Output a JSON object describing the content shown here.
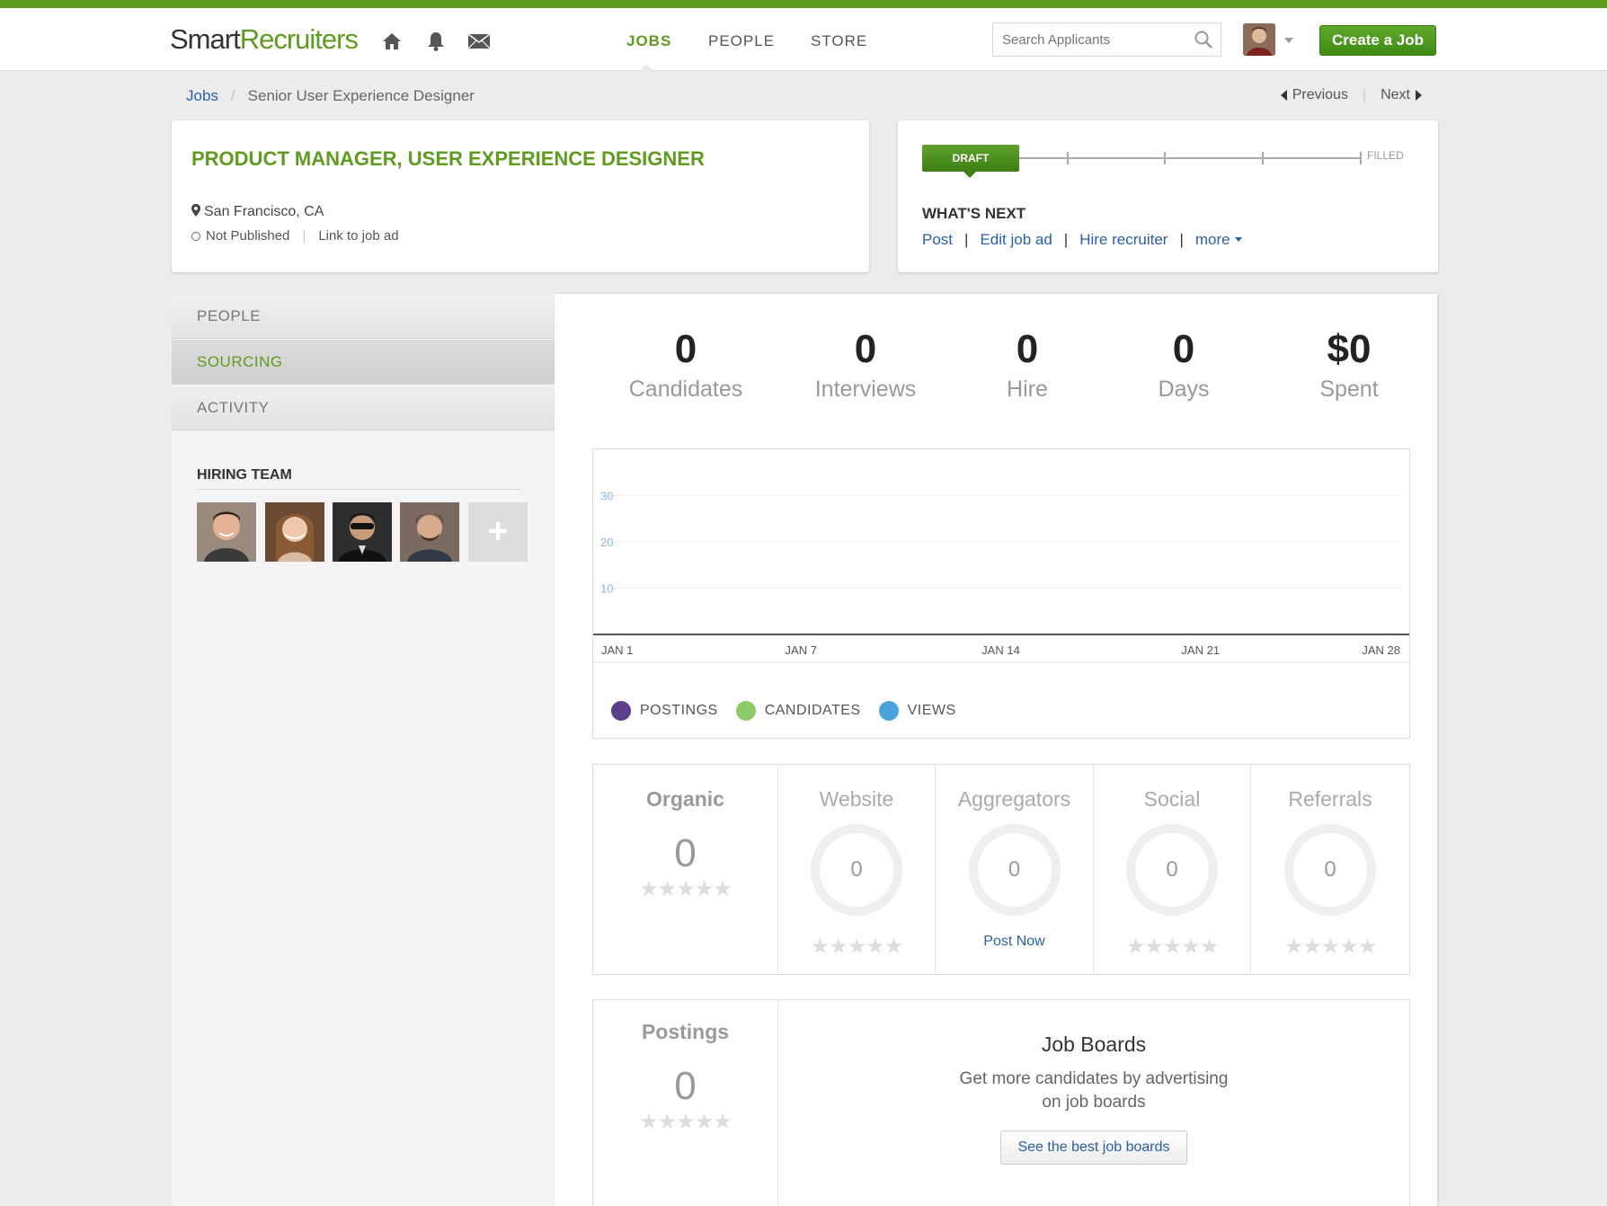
{
  "header": {
    "logo_part1": "Smart",
    "logo_part2": "Recruiters",
    "nav": [
      {
        "label": "JOBS",
        "active": true
      },
      {
        "label": "PEOPLE",
        "active": false
      },
      {
        "label": "STORE",
        "active": false
      }
    ],
    "search_placeholder": "Search Applicants",
    "create_label": "Create a Job",
    "accent_color": "#5e9b1f"
  },
  "breadcrumb": {
    "root": "Jobs",
    "current": "Senior User Experience Designer"
  },
  "pager": {
    "previous": "Previous",
    "next": "Next"
  },
  "job": {
    "title": "PRODUCT MANAGER, USER EXPERIENCE DESIGNER",
    "location": "San Francisco, CA",
    "status": "Not Published",
    "link": "Link to job ad"
  },
  "workflow": {
    "current_stage": "DRAFT",
    "end_stage": "FILLED",
    "whats_next_title": "WHAT'S NEXT",
    "links": [
      "Post",
      "Edit job ad",
      "Hire recruiter",
      "more"
    ]
  },
  "sidebar": {
    "tabs": [
      {
        "label": "PEOPLE",
        "active": false
      },
      {
        "label": "SOURCING",
        "active": true
      },
      {
        "label": "ACTIVITY",
        "active": false
      }
    ],
    "team_title": "HIRING TEAM",
    "add_label": "+"
  },
  "stats": [
    {
      "value": "0",
      "label": "Candidates"
    },
    {
      "value": "0",
      "label": "Interviews"
    },
    {
      "value": "0",
      "label": "Hire"
    },
    {
      "value": "0",
      "label": "Days"
    },
    {
      "value": "$0",
      "label": "Spent"
    }
  ],
  "chart_data": {
    "type": "line",
    "x": [
      "JAN 1",
      "JAN 7",
      "JAN 14",
      "JAN 21",
      "JAN 28"
    ],
    "yticks": [
      10,
      20,
      30
    ],
    "ylim": [
      0,
      40
    ],
    "series": [
      {
        "name": "POSTINGS",
        "color": "#5b3f8a",
        "values": [
          0,
          0,
          0,
          0,
          0
        ]
      },
      {
        "name": "CANDIDATES",
        "color": "#8cc967",
        "values": [
          0,
          0,
          0,
          0,
          0
        ]
      },
      {
        "name": "VIEWS",
        "color": "#4aa3db",
        "values": [
          0,
          0,
          0,
          0,
          0
        ]
      }
    ],
    "grid": true,
    "legend": "bottom-left"
  },
  "sources": [
    {
      "title": "Organic",
      "value": "0",
      "stars": "★★★★★"
    },
    {
      "title": "Website",
      "value": "0",
      "stars": "★★★★★"
    },
    {
      "title": "Aggregators",
      "value": "0",
      "action": "Post Now"
    },
    {
      "title": "Social",
      "value": "0",
      "stars": "★★★★★"
    },
    {
      "title": "Referrals",
      "value": "0",
      "stars": "★★★★★"
    }
  ],
  "postings": {
    "title": "Postings",
    "value": "0",
    "stars": "★★★★★"
  },
  "job_boards": {
    "title": "Job Boards",
    "line1": "Get more candidates by advertising",
    "line2": "on job boards",
    "button": "See the best job boards"
  }
}
